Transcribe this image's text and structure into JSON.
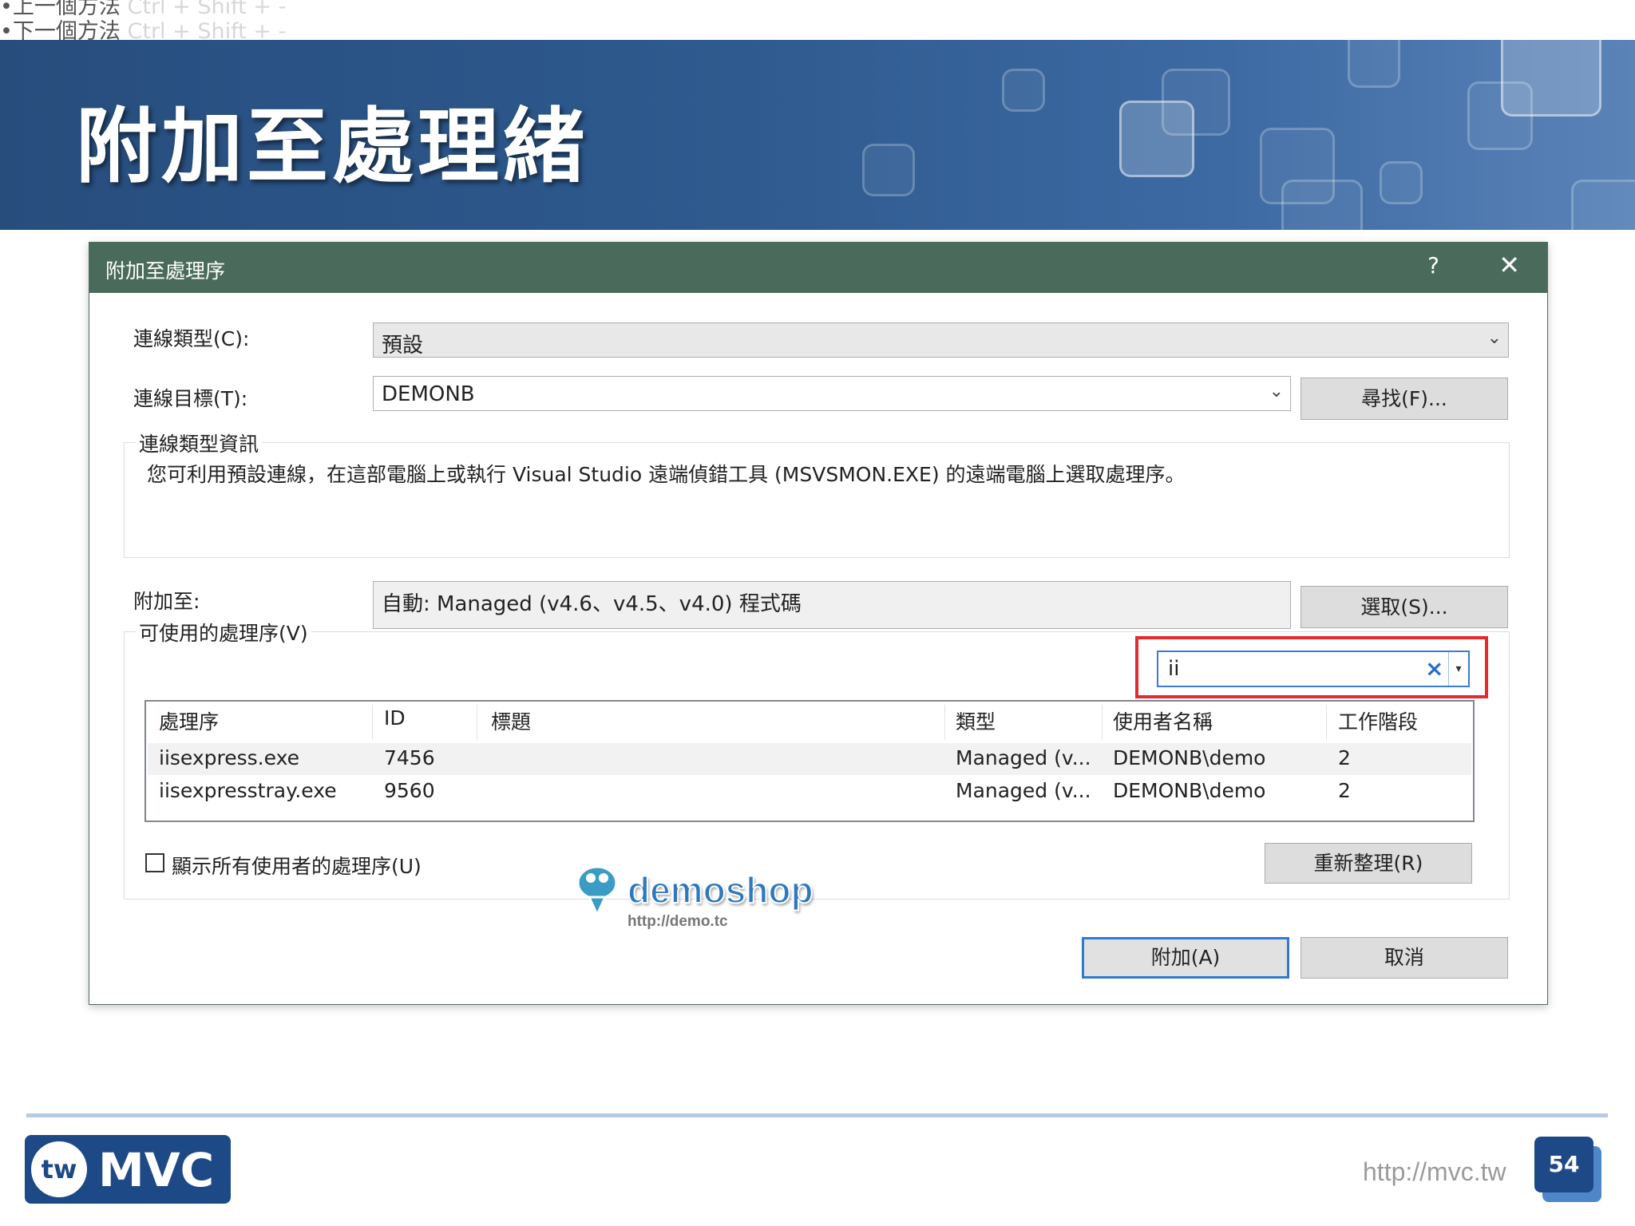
{
  "slide": {
    "hints": [
      {
        "prefix": "•上一個方法 ",
        "keys": "Ctrl + Shift + -"
      },
      {
        "prefix": "•下一個方法 ",
        "keys": "Ctrl + Shift + -"
      }
    ],
    "title": "附加至處理緒",
    "footer_url": "http://mvc.tw",
    "page_number": "54",
    "logo": {
      "badge": "tw",
      "text": "MVC"
    },
    "watermark": {
      "name": "demoshop",
      "url": "http://demo.tc"
    }
  },
  "dialog": {
    "title": "附加至處理序",
    "help_label": "?",
    "close_label": "✕",
    "connection_type": {
      "label": "連線類型(C):",
      "value": "預設"
    },
    "connection_target": {
      "label": "連線目標(T):",
      "value": "DEMONB",
      "find_button": "尋找(F)..."
    },
    "info_group": {
      "legend": "連線類型資訊",
      "text": "您可利用預設連線，在這部電腦上或執行 Visual Studio 遠端偵錯工具 (MSVSMON.EXE) 的遠端電腦上選取處理序。"
    },
    "attach_to": {
      "label": "附加至:",
      "value": "自動: Managed (v4.6、v4.5、v4.0) 程式碼",
      "select_button": "選取(S)..."
    },
    "processes_group": {
      "legend": "可使用的處理序(V)",
      "filter_value": "ii",
      "filter_clear": "×",
      "filter_dropdown": "▾",
      "columns": [
        "處理序",
        "ID",
        "標題",
        "類型",
        "使用者名稱",
        "工作階段"
      ],
      "rows": [
        [
          "iisexpress.exe",
          "7456",
          "",
          "Managed (v...",
          "DEMONB\\demo",
          "2"
        ],
        [
          "iisexpresstray.exe",
          "9560",
          "",
          "Managed (v...",
          "DEMONB\\demo",
          "2"
        ]
      ],
      "show_all_label": "顯示所有使用者的處理序(U)",
      "show_all_checked": false,
      "refresh_button": "重新整理(R)"
    },
    "attach_button": "附加(A)",
    "cancel_button": "取消"
  }
}
